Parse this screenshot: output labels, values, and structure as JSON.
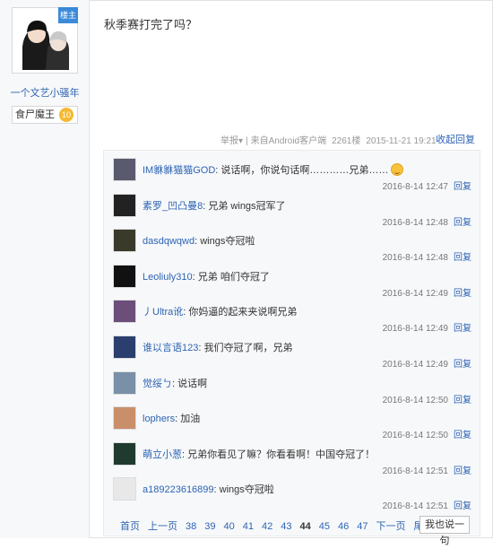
{
  "user": {
    "badge": "楼主",
    "name": "一个文艺小骚年",
    "title": "食尸魔王",
    "level": "10"
  },
  "post": {
    "content": "秋季赛打完了吗？",
    "report": "举报",
    "report_arrow": "▾",
    "source": "来自Android客户端",
    "floor": "2261楼",
    "time": "2015-11-21 19:21",
    "collapse": "收起回复"
  },
  "replies": [
    {
      "user": "IM貅貅猫猫GOD",
      "text": "说话啊，你说句话啊…………兄弟……",
      "time": "2016-8-14 12:47",
      "reply": "回复",
      "avatar": "#5a5a6e"
    },
    {
      "user": "素罗_凹凸曼8",
      "text": "兄弟 wings冠军了",
      "time": "2016-8-14 12:48",
      "reply": "回复",
      "avatar": "#222222"
    },
    {
      "user": "dasdqwqwd",
      "text": "wings夺冠啦",
      "time": "2016-8-14 12:48",
      "reply": "回复",
      "avatar": "#3a3a2a"
    },
    {
      "user": "Leoliuly310",
      "text": "兄弟 咱们夺冠了",
      "time": "2016-8-14 12:49",
      "reply": "回复",
      "avatar": "#111111"
    },
    {
      "user": "丿Ultra讹",
      "text": "你妈逼的起来夹说啊兄弟",
      "time": "2016-8-14 12:49",
      "reply": "回复",
      "avatar": "#6b4f7a"
    },
    {
      "user": "谁以言语123",
      "text": "我们夺冠了啊，兄弟",
      "time": "2016-8-14 12:49",
      "reply": "回复",
      "avatar": "#2a3f6e"
    },
    {
      "user": "觉绥ㄅ",
      "text": "说话啊",
      "time": "2016-8-14 12:50",
      "reply": "回复",
      "avatar": "#7a8fa8"
    },
    {
      "user": "lophers",
      "text": "加油",
      "time": "2016-8-14 12:50",
      "reply": "回复",
      "avatar": "#c98e6a"
    },
    {
      "user": "萌立小葱",
      "text": "兄弟你看见了嘛？你看看啊！中国夺冠了！",
      "time": "2016-8-14 12:51",
      "reply": "回复",
      "avatar": "#1f3a2e"
    },
    {
      "user": "a189223616899",
      "text": "wings夺冠啦",
      "time": "2016-8-14 12:51",
      "reply": "回复",
      "avatar": "#e8e8e8"
    }
  ],
  "pager": {
    "first": "首页",
    "prev": "上一页",
    "pages": [
      "38",
      "39",
      "40",
      "41",
      "42",
      "43",
      "44",
      "45",
      "46",
      "47"
    ],
    "current": "44",
    "next": "下一页",
    "last": "尾页",
    "say": "我也说一句"
  }
}
